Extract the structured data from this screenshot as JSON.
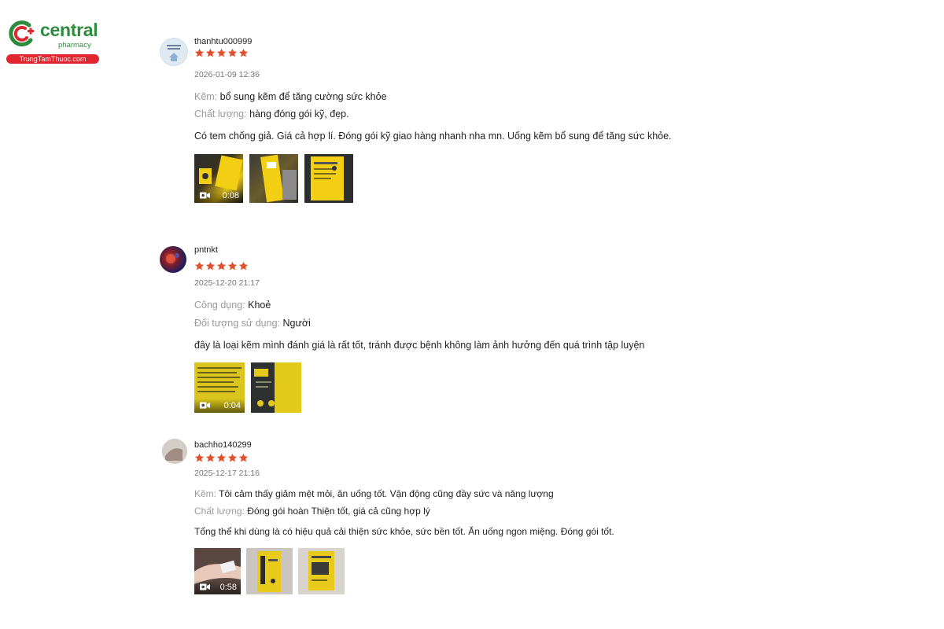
{
  "logo": {
    "word": "central",
    "sub": "pharmacy",
    "site": "TrungTamThuoc.com",
    "colors": {
      "green": "#2e8b3d",
      "red": "#e0262e"
    }
  },
  "star_color": "#e0502c",
  "reviews": [
    {
      "username": "thanhtu000999",
      "rating": 5,
      "date": "2026-01-09 12:36",
      "attributes": [
        {
          "key": "Kẽm:",
          "value": "bổ sung kẽm để tăng cường sức khỏe"
        },
        {
          "key": "Chất lượng:",
          "value": "hàng đóng gói kỹ, đẹp."
        }
      ],
      "text": "Có tem chống giả. Giá cả hợp lí. Đóng gói kỹ giao hàng nhanh nha mn. Uống kẽm bổ sung để tăng sức khỏe.",
      "media": [
        {
          "type": "video",
          "duration": "0:08"
        },
        {
          "type": "image"
        },
        {
          "type": "image"
        }
      ]
    },
    {
      "username": "pntnkt",
      "rating": 5,
      "date": "2025-12-20 21:17",
      "attributes": [
        {
          "key": "Công dụng:",
          "value": "Khoẻ"
        },
        {
          "key": "Đối tượng sử dụng:",
          "value": "Người"
        }
      ],
      "text": "đây là loại kẽm mình đánh giá là rất tốt, tránh được bệnh không làm ảnh hưởng đến quá trình tập luyện",
      "media": [
        {
          "type": "video",
          "duration": "0:04"
        },
        {
          "type": "image"
        }
      ]
    },
    {
      "username": "bachho140299",
      "rating": 5,
      "date": "2025-12-17 21:16",
      "attributes": [
        {
          "key": "Kẽm:",
          "value": "Tôi cảm thấy giảm mệt mỏi, ăn uống tốt. Vận động cũng đầy sức và năng lượng"
        },
        {
          "key": "Chất lượng:",
          "value": "Đóng gói hoàn Thiện tốt, giá cả cũng hợp lý"
        }
      ],
      "text": "Tổng thể khi dùng là có hiệu quả cải thiện sức khỏe, sức bền tốt. Ăn uống ngon miệng. Đóng gói tốt.",
      "media": [
        {
          "type": "video",
          "duration": "0:58"
        },
        {
          "type": "image"
        },
        {
          "type": "image"
        }
      ]
    }
  ]
}
